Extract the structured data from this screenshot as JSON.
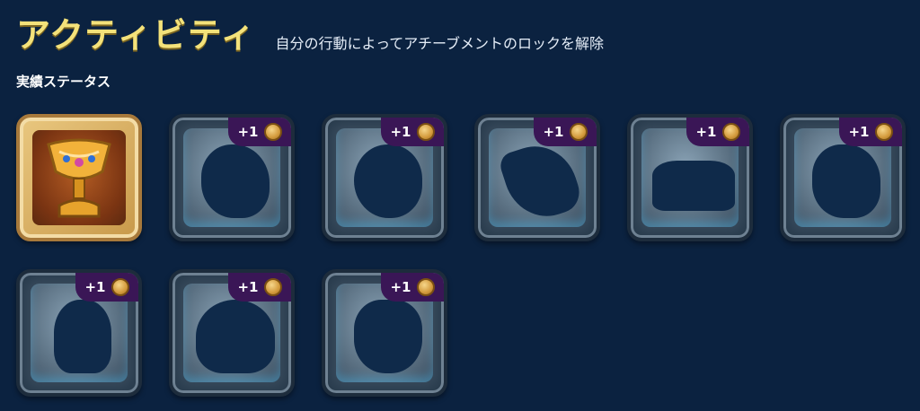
{
  "header": {
    "title": "アクティビティ",
    "subtitle": "自分の行動によってアチーブメントのロックを解除"
  },
  "section": {
    "title": "実績ステータス"
  },
  "achievements": [
    {
      "state": "unlocked",
      "icon": "trophy-icon"
    },
    {
      "state": "locked",
      "reward": "+1",
      "icon": "locked-achievement-silhouette"
    },
    {
      "state": "locked",
      "reward": "+1",
      "icon": "locked-achievement-silhouette"
    },
    {
      "state": "locked",
      "reward": "+1",
      "icon": "locked-achievement-silhouette"
    },
    {
      "state": "locked",
      "reward": "+1",
      "icon": "locked-achievement-silhouette"
    },
    {
      "state": "locked",
      "reward": "+1",
      "icon": "locked-achievement-silhouette"
    },
    {
      "state": "locked",
      "reward": "+1",
      "icon": "locked-achievement-silhouette"
    },
    {
      "state": "locked",
      "reward": "+1",
      "icon": "locked-achievement-silhouette"
    },
    {
      "state": "locked",
      "reward": "+1",
      "icon": "locked-achievement-silhouette"
    }
  ],
  "colors": {
    "background": "#0b2240",
    "title": "#f4e27a",
    "badge": "#3a1656",
    "coin": "#d39a3c"
  }
}
